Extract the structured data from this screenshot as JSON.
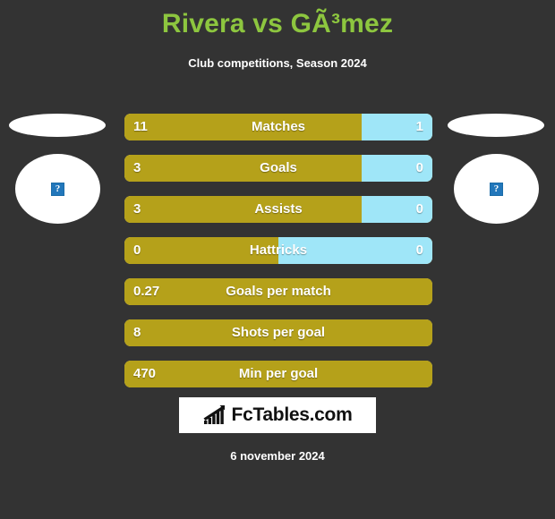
{
  "header": {
    "title": "Rivera vs GÃ³mez",
    "subtitle": "Club competitions, Season 2024"
  },
  "players": {
    "left": {
      "flag_icon": "flag-placeholder",
      "photo_icon": "broken-image-icon",
      "photo_glyph": "?"
    },
    "right": {
      "flag_icon": "flag-placeholder",
      "photo_icon": "broken-image-icon",
      "photo_glyph": "?"
    }
  },
  "colors": {
    "background": "#333333",
    "title": "#8DC63F",
    "bar_left": "#B5A11A",
    "bar_right": "#9FE6F8",
    "text": "#FFFFFF"
  },
  "chart_data": {
    "type": "bar",
    "title": "Rivera vs GÃ³mez",
    "subtitle": "Club competitions, Season 2024",
    "orientation": "horizontal-diverging",
    "series": [
      {
        "name": "Rivera",
        "color": "#B5A11A",
        "values": [
          11,
          3,
          3,
          0,
          0.27,
          8,
          470
        ]
      },
      {
        "name": "GÃ³mez",
        "color": "#9FE6F8",
        "values": [
          1,
          0,
          0,
          0,
          null,
          null,
          null
        ]
      }
    ],
    "categories": [
      "Matches",
      "Goals",
      "Assists",
      "Hattricks",
      "Goals per match",
      "Shots per goal",
      "Min per goal"
    ],
    "rows": [
      {
        "label": "Matches",
        "left_value": "11",
        "right_value": "1",
        "left_pct": 77,
        "has_right": true
      },
      {
        "label": "Goals",
        "left_value": "3",
        "right_value": "0",
        "left_pct": 77,
        "has_right": true
      },
      {
        "label": "Assists",
        "left_value": "3",
        "right_value": "0",
        "left_pct": 77,
        "has_right": true
      },
      {
        "label": "Hattricks",
        "left_value": "0",
        "right_value": "0",
        "left_pct": 50,
        "has_right": true
      },
      {
        "label": "Goals per match",
        "left_value": "0.27",
        "right_value": "",
        "left_pct": 100,
        "has_right": false
      },
      {
        "label": "Shots per goal",
        "left_value": "8",
        "right_value": "",
        "left_pct": 100,
        "has_right": false
      },
      {
        "label": "Min per goal",
        "left_value": "470",
        "right_value": "",
        "left_pct": 100,
        "has_right": false
      }
    ],
    "grid": false,
    "legend": "none"
  },
  "footer": {
    "logo_text": "FcTables.com",
    "logo_icon": "bar-chart-growth-icon",
    "date": "6 november 2024"
  }
}
